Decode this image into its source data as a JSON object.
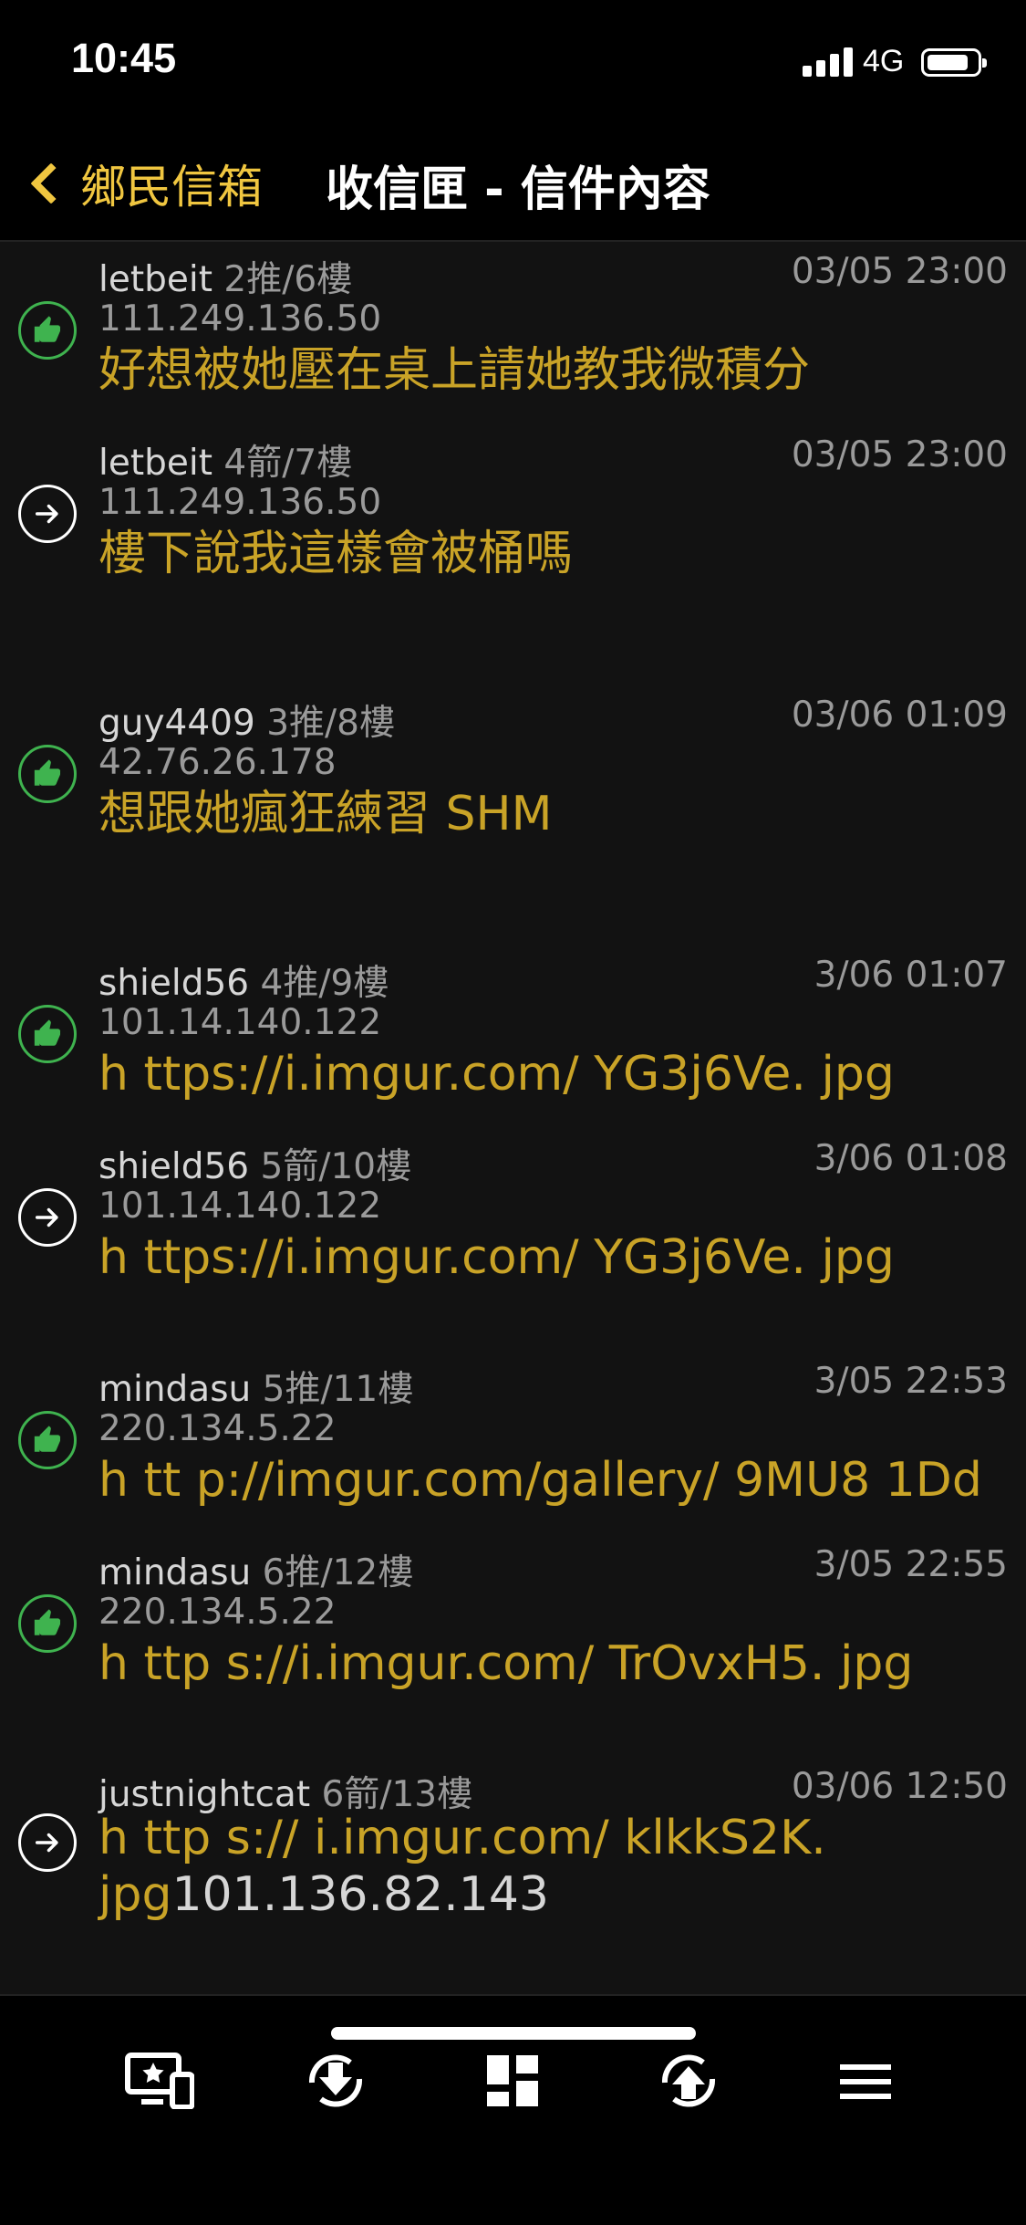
{
  "status": {
    "time": "10:45",
    "network": "4G"
  },
  "nav": {
    "back_label": "鄉民信箱",
    "title": "收信匣 - 信件內容"
  },
  "comments": [
    {
      "type": "push",
      "user": "letbeit",
      "floor": "2推/6樓",
      "date": "03/05 23:00",
      "ip": "111.249.136.50",
      "text": "好想被她壓在桌上請她教我微積分"
    },
    {
      "type": "arrow",
      "user": "letbeit",
      "floor": "4箭/7樓",
      "date": "03/05 23:00",
      "ip": "111.249.136.50",
      "text": "樓下說我這樣會被桶嗎"
    },
    {
      "type": "push",
      "user": "guy4409",
      "floor": "3推/8樓",
      "date": "03/06 01:09",
      "ip": "42.76.26.178",
      "text": "想跟她瘋狂練習 SHM"
    },
    {
      "type": "push",
      "user": "shield56",
      "floor": "4推/9樓",
      "date": "3/06 01:07",
      "ip": "101.14.140.122",
      "text": "h ttps://i.imgur.com/ YG3j6Ve. jpg"
    },
    {
      "type": "arrow",
      "user": "shield56",
      "floor": "5箭/10樓",
      "date": "3/06 01:08",
      "ip": "101.14.140.122",
      "text": "h ttps://i.imgur.com/ YG3j6Ve. jpg"
    },
    {
      "type": "push",
      "user": "mindasu",
      "floor": "5推/11樓",
      "date": "3/05 22:53",
      "ip": "220.134.5.22",
      "text": "h tt p://imgur.com/gallery/ 9MU8 1Dd"
    },
    {
      "type": "push",
      "user": "mindasu",
      "floor": "6推/12樓",
      "date": "3/05 22:55",
      "ip": "220.134.5.22",
      "text": "h ttp s://i.imgur.com/ TrOvxH5. jpg"
    },
    {
      "type": "arrow",
      "user": "justnightcat",
      "floor": "6箭/13樓",
      "date": "03/06 12:50",
      "text_line1": "h ttp s:// i.imgur.com/ klkkS2K.",
      "text_line2": "jpg",
      "ip_inline": "101.136.82.143"
    }
  ],
  "colors": {
    "accent": "#f0c640",
    "comment_text": "#c9a327",
    "push_icon": "#3fb34f"
  }
}
